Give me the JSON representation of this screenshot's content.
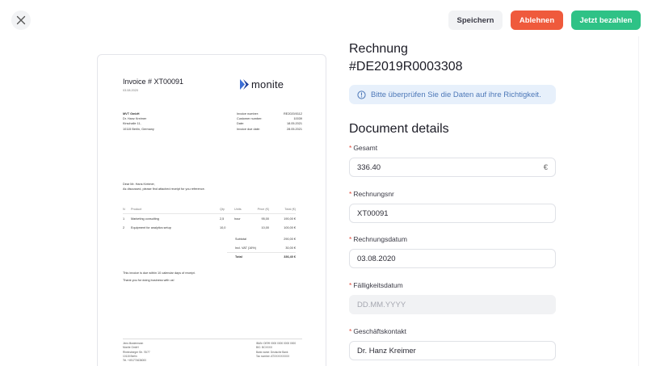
{
  "topbar": {
    "save_label": "Speichern",
    "reject_label": "Ablehnen",
    "pay_label": "Jetzt bezahlen",
    "colors": {
      "reject": "#ef5a3c",
      "pay": "#2ec286"
    }
  },
  "invoice": {
    "title": "Invoice # XT00091",
    "date": "03.08.2020",
    "logo_text": "monite",
    "from": {
      "company": "MVT GmbH",
      "contact": "Dr. Hanz Kreimer",
      "street": "Kirschalle 11,",
      "city": "10115 Berlin, Germany"
    },
    "meta": [
      {
        "label": "Invoice number:",
        "value": "RE2020/0112"
      },
      {
        "label": "Customer number:",
        "value": "10039"
      },
      {
        "label": "Date:",
        "value": "18.05.2021"
      },
      {
        "label": "Invoice due date:",
        "value": "28.05.2021"
      }
    ],
    "letter": {
      "greeting": "Dear Mr. Hans Kreimer,",
      "body": "As discussed, please find attached receipt for you reference."
    },
    "table": {
      "headers": [
        "N",
        "Product",
        "Qty",
        "Units",
        "Price (€)",
        "Total (€)"
      ],
      "rows": [
        [
          "1",
          "Marketing consulting",
          "2,5",
          "hour",
          "95,00",
          "190,00 €"
        ],
        [
          "2",
          "Equipment for analytics setup",
          "10,0",
          "",
          "10,00",
          "100,00 €"
        ]
      ]
    },
    "totals": [
      {
        "label": "Subtotal",
        "value": "290,00 €"
      },
      {
        "label": "Incl. VAT (16%)",
        "value": "30,00 €"
      },
      {
        "label": "Total",
        "value": "336,40 €"
      }
    ],
    "notes": {
      "due": "This invoice is due within 10 calendar days of receipt.",
      "thanks": "Thank you for doing business with us!"
    },
    "footer_left": [
      "Jens Mustermann",
      "Monite GmbH",
      "Rheinsberger Str. 76/77",
      "10115 Berlin",
      "Tel. +491774636000"
    ],
    "footer_right": [
      "IBAN: DE99 0000 0000 0000 0000",
      "BIC: BCXXXX",
      "Bank name: Deutsche Bank",
      "Tax number: ATXXXXXXXXX"
    ]
  },
  "panel": {
    "title_line1": "Rechnung",
    "title_line2": "#DE2019R0003308",
    "info_text": "Bitte überprüfen Sie die Daten auf ihre Richtigkeit.",
    "section_title": "Document details",
    "fields": {
      "total": {
        "label": "Gesamt",
        "value": "336.40",
        "suffix": "€",
        "required": "*"
      },
      "invoice_no": {
        "label": "Rechnungsnr",
        "value": "XT00091",
        "required": "*"
      },
      "invoice_date": {
        "label": "Rechnungsdatum",
        "value": "03.08.2020",
        "required": "*"
      },
      "due_date": {
        "label": "Fälligkeitsdatum",
        "placeholder": "DD.MM.YYYY",
        "required": "*"
      },
      "contact": {
        "label": "Geschäftskontakt",
        "value": "Dr. Hanz Kreimer",
        "required": "*"
      }
    }
  }
}
